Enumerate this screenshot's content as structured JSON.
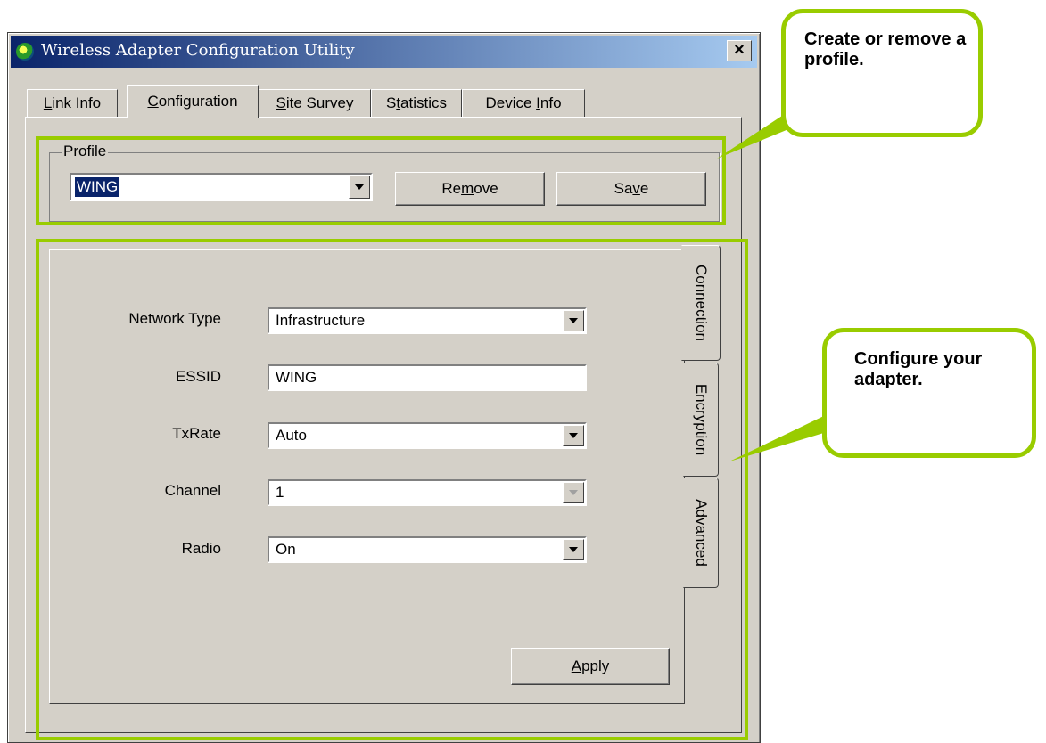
{
  "window": {
    "title": "Wireless Adapter Configuration Utility",
    "close_label": "×"
  },
  "tabs": [
    {
      "pre": "",
      "u": "L",
      "post": "ink Info"
    },
    {
      "pre": "",
      "u": "C",
      "post": "onfiguration"
    },
    {
      "pre": "",
      "u": "S",
      "post": "ite Survey"
    },
    {
      "pre": "S",
      "u": "t",
      "post": "atistics"
    },
    {
      "pre": "Device ",
      "u": "I",
      "post": "nfo"
    }
  ],
  "active_tab": "Configuration",
  "profile": {
    "group_label": "Profile",
    "selected": "WING",
    "remove": {
      "pre": "Re",
      "u": "m",
      "post": "ove"
    },
    "save": {
      "pre": "Sa",
      "u": "v",
      "post": "e"
    }
  },
  "side_tabs": [
    "Connection",
    "Encryption",
    "Advanced"
  ],
  "connection": {
    "fields": [
      {
        "label": "Network Type",
        "value": "Infrastructure",
        "type": "dropdown"
      },
      {
        "label": "ESSID",
        "value": "WING",
        "type": "text"
      },
      {
        "label": "TxRate",
        "value": "Auto",
        "type": "dropdown"
      },
      {
        "label": "Channel",
        "value": "1",
        "type": "dropdown-disabled"
      },
      {
        "label": "Radio",
        "value": "On",
        "type": "dropdown"
      }
    ],
    "apply": {
      "pre": "",
      "u": "A",
      "post": "pply"
    }
  },
  "callouts": {
    "profile": "Create or remove a profile.",
    "adapter": "Configure your adapter."
  },
  "colors": {
    "annotation_green": "#99cc00",
    "window_bg": "#d4d0c8",
    "titlebar_start": "#0a246a",
    "titlebar_end": "#a6caf0",
    "selection": "#0a246a"
  }
}
